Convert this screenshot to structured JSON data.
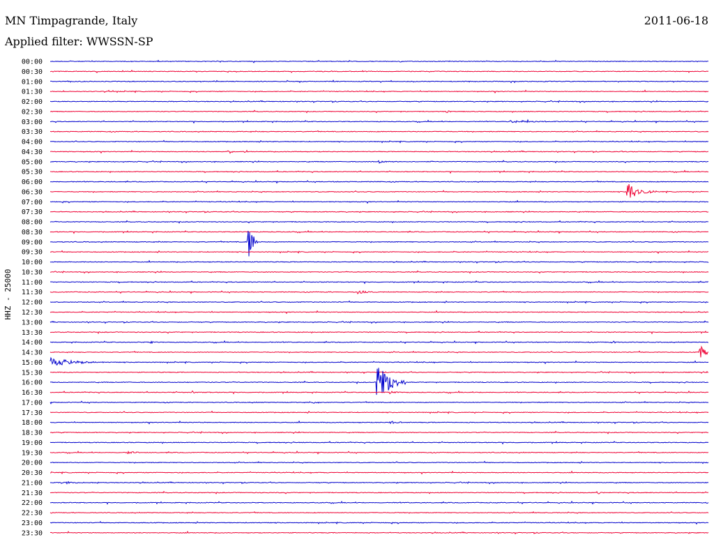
{
  "header": {
    "station": "MN Timpagrande, Italy",
    "date": "2011-06-18",
    "filter": "Applied filter: WWSSN-SP"
  },
  "chart_data": {
    "type": "line",
    "title": "MN Timpagrande, Italy",
    "subtitle": "Applied filter: WWSSN-SP",
    "ylabel": "HHZ - 25000",
    "xlabel": "",
    "colors": {
      "even_row": "#0000cc",
      "odd_row": "#ee0033"
    },
    "rows": [
      "00:00",
      "00:30",
      "01:00",
      "01:30",
      "02:00",
      "02:30",
      "03:00",
      "03:30",
      "04:00",
      "04:30",
      "05:00",
      "05:30",
      "06:00",
      "06:30",
      "07:00",
      "07:30",
      "08:00",
      "08:30",
      "09:00",
      "09:30",
      "10:00",
      "10:30",
      "11:00",
      "11:30",
      "12:00",
      "12:30",
      "13:00",
      "13:30",
      "14:00",
      "14:30",
      "15:00",
      "15:30",
      "16:00",
      "16:30",
      "17:00",
      "17:30",
      "18:00",
      "18:30",
      "19:00",
      "19:30",
      "20:00",
      "20:30",
      "21:00",
      "21:30",
      "22:00",
      "22:30",
      "23:00",
      "23:30"
    ],
    "x_range_minutes": [
      0,
      30
    ],
    "events": [
      {
        "row": "06:30",
        "minute": 26.3,
        "amplitude": 16,
        "duration_min": 1.2
      },
      {
        "row": "09:00",
        "minute": 9.0,
        "amplitude": 32,
        "duration_min": 0.5
      },
      {
        "row": "15:00",
        "minute": 0.0,
        "amplitude": 7,
        "duration_min": 2.5
      },
      {
        "row": "16:00",
        "minute": 14.9,
        "amplitude": 36,
        "duration_min": 1.3
      },
      {
        "row": "14:30",
        "minute": 29.6,
        "amplitude": 12,
        "duration_min": 0.5
      },
      {
        "row": "11:30",
        "minute": 14.0,
        "amplitude": 3,
        "duration_min": 0.8
      },
      {
        "row": "04:30",
        "minute": 8.1,
        "amplitude": 4,
        "duration_min": 0.3
      },
      {
        "row": "02:30",
        "minute": 18.0,
        "amplitude": 2,
        "duration_min": 0.7
      },
      {
        "row": "03:00",
        "minute": 21.0,
        "amplitude": 2,
        "duration_min": 2.0
      },
      {
        "row": "05:00",
        "minute": 15.0,
        "amplitude": 2,
        "duration_min": 1.0
      },
      {
        "row": "16:30",
        "minute": 6.5,
        "amplitude": 2,
        "duration_min": 0.3
      },
      {
        "row": "16:30",
        "minute": 15.5,
        "amplitude": 2,
        "duration_min": 0.8
      },
      {
        "row": "17:00",
        "minute": 12.0,
        "amplitude": 2,
        "duration_min": 0.5
      },
      {
        "row": "18:00",
        "minute": 15.5,
        "amplitude": 2,
        "duration_min": 1.0
      },
      {
        "row": "19:30",
        "minute": 3.5,
        "amplitude": 2,
        "duration_min": 1.0
      },
      {
        "row": "21:00",
        "minute": 0.5,
        "amplitude": 2,
        "duration_min": 1.5
      },
      {
        "row": "21:30",
        "minute": 25.0,
        "amplitude": 2,
        "duration_min": 0.3
      },
      {
        "row": "14:00",
        "minute": 4.6,
        "amplitude": 2,
        "duration_min": 0.2
      },
      {
        "row": "14:00",
        "minute": 25.6,
        "amplitude": 2,
        "duration_min": 0.3
      }
    ]
  }
}
